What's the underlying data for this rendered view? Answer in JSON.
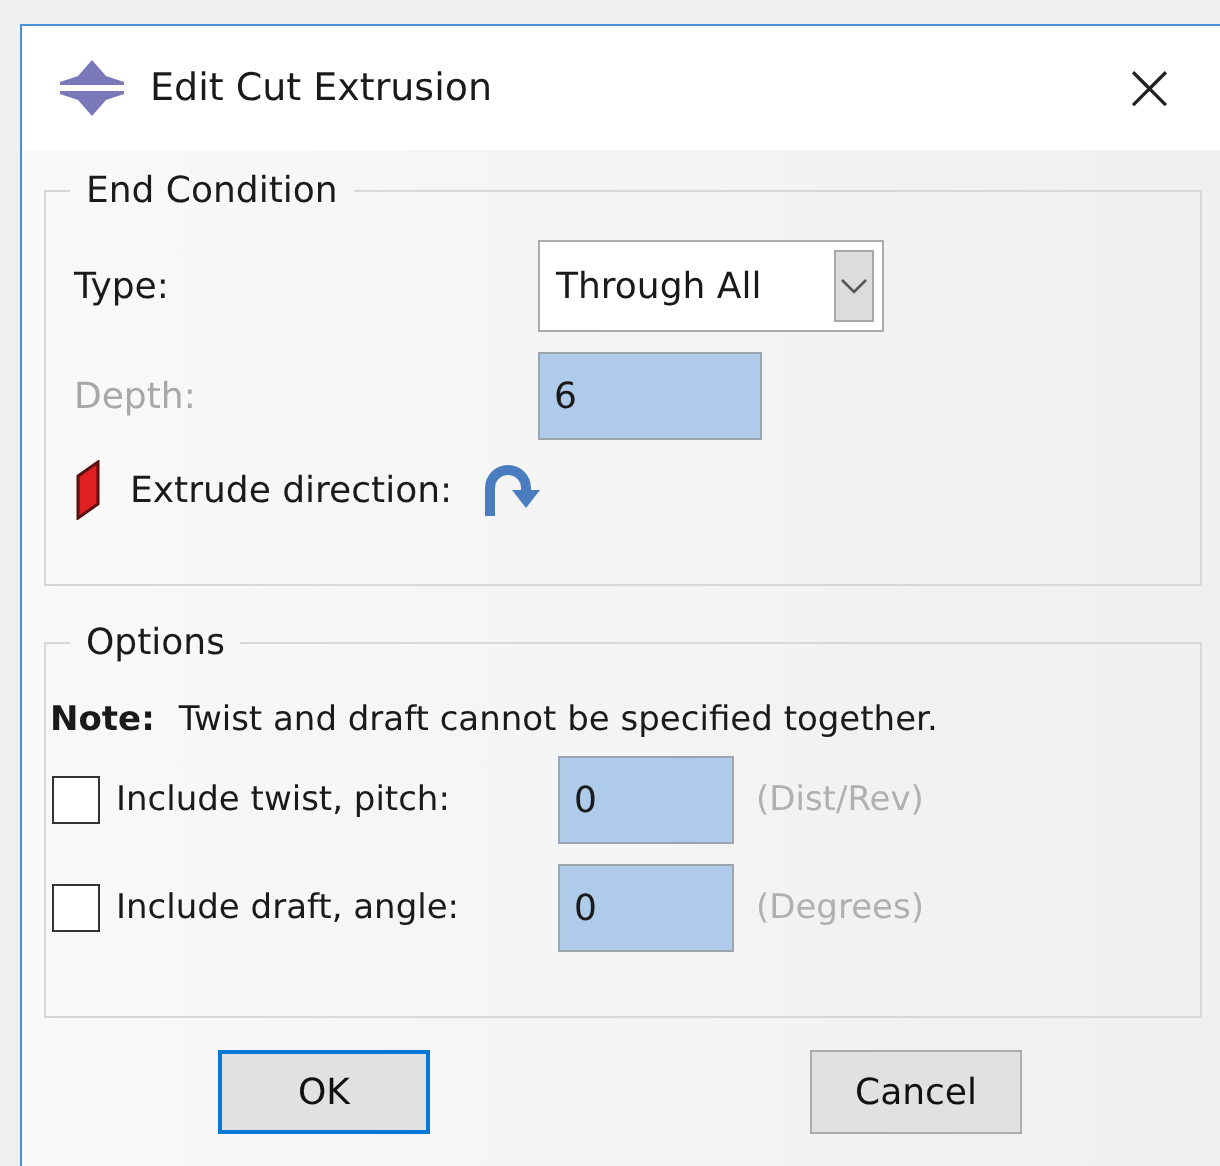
{
  "window": {
    "title": "Edit Cut Extrusion",
    "close": "×"
  },
  "end_condition": {
    "title": "End Condition",
    "type": {
      "label": "Type:",
      "value": "Through All"
    },
    "depth": {
      "label": "Depth:",
      "value": "6",
      "disabled": true
    },
    "direction": {
      "label": "Extrude direction:"
    }
  },
  "options": {
    "title": "Options",
    "note_label": "Note:",
    "note": "Twist and draft cannot be specified together.",
    "rows": [
      {
        "label": "Include twist, pitch:",
        "checked": false,
        "value": "0",
        "unit": "(Dist/Rev)"
      },
      {
        "label": "Include draft, angle:",
        "checked": false,
        "value": "0",
        "unit": "(Degrees)"
      }
    ]
  },
  "buttons": [
    {
      "label": "OK",
      "default": true
    },
    {
      "label": "Cancel",
      "default": false
    }
  ]
}
